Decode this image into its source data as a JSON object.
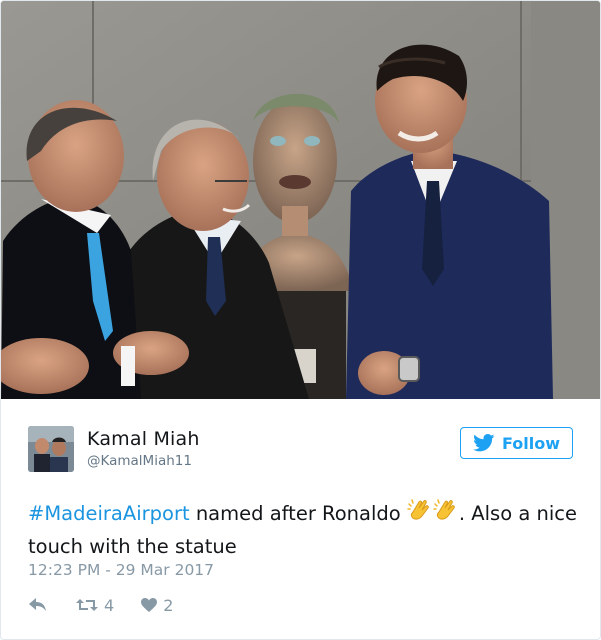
{
  "photo": {
    "alt_icon": "photo-image"
  },
  "user": {
    "display_name": "Kamal Miah",
    "handle": "@KamalMiah11",
    "avatar_icon": "avatar-photo"
  },
  "follow": {
    "label": "Follow",
    "icon": "bird-icon",
    "accent": "#1da1f2"
  },
  "tweet": {
    "hashtag": "#MadeiraAirport",
    "text_after_hashtag": " named after Ronaldo ",
    "emoji": [
      "clapping-hands",
      "clapping-hands"
    ],
    "text_end": ". Also a nice touch with the statue",
    "hashtag_color": "#1b95e0"
  },
  "timestamp": "12:23 PM - 29 Mar 2017",
  "actions": {
    "reply_icon": "reply-icon",
    "retweet_icon": "retweet-icon",
    "retweet_count": "4",
    "like_icon": "heart-icon",
    "like_count": "2"
  }
}
